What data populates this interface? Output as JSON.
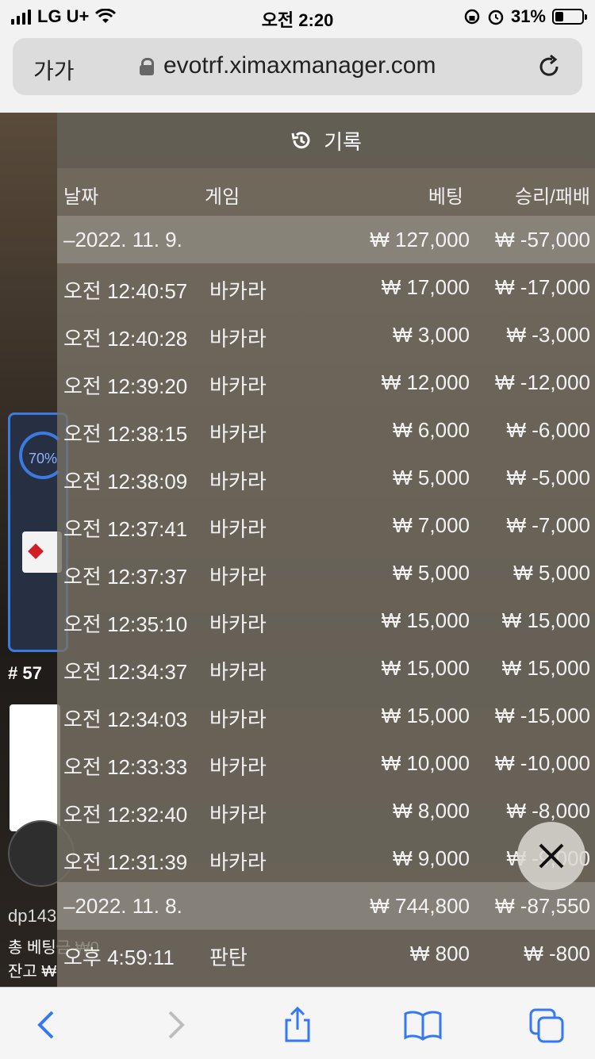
{
  "status_bar": {
    "carrier": "LG U+",
    "time": "오전 2:20",
    "battery": "31%",
    "battery_level": 0.31
  },
  "browser": {
    "text_size_button": "가가",
    "url": "evotrf.ximaxmanager.com"
  },
  "background_page": {
    "progress": "70%",
    "table_number": "# 57",
    "username": "dp143",
    "total_bet": "총 베팅금 ₩0",
    "balance": "잔고 ₩"
  },
  "history_panel": {
    "title": "기록",
    "columns": {
      "date": "날짜",
      "game": "게임",
      "bet": "베팅",
      "result": "승리/패배"
    },
    "rows": [
      {
        "type": "date",
        "date": "–2022. 11. 9.",
        "bet": "₩ 127,000",
        "result": "₩ -57,000"
      },
      {
        "type": "entry",
        "time": "오전 12:40:57",
        "game": "바카라",
        "bet": "₩ 17,000",
        "result": "₩ -17,000"
      },
      {
        "type": "entry",
        "time": "오전 12:40:28",
        "game": "바카라",
        "bet": "₩ 3,000",
        "result": "₩ -3,000"
      },
      {
        "type": "entry",
        "time": "오전 12:39:20",
        "game": "바카라",
        "bet": "₩ 12,000",
        "result": "₩ -12,000"
      },
      {
        "type": "entry",
        "time": "오전 12:38:15",
        "game": "바카라",
        "bet": "₩ 6,000",
        "result": "₩ -6,000"
      },
      {
        "type": "entry",
        "time": "오전 12:38:09",
        "game": "바카라",
        "bet": "₩ 5,000",
        "result": "₩ -5,000"
      },
      {
        "type": "entry",
        "time": "오전 12:37:41",
        "game": "바카라",
        "bet": "₩ 7,000",
        "result": "₩ -7,000"
      },
      {
        "type": "entry",
        "time": "오전 12:37:37",
        "game": "바카라",
        "bet": "₩ 5,000",
        "result": "₩ 5,000"
      },
      {
        "type": "entry",
        "time": "오전 12:35:10",
        "game": "바카라",
        "bet": "₩ 15,000",
        "result": "₩ 15,000"
      },
      {
        "type": "entry",
        "time": "오전 12:34:37",
        "game": "바카라",
        "bet": "₩ 15,000",
        "result": "₩ 15,000"
      },
      {
        "type": "entry",
        "time": "오전 12:34:03",
        "game": "바카라",
        "bet": "₩ 15,000",
        "result": "₩ -15,000"
      },
      {
        "type": "entry",
        "time": "오전 12:33:33",
        "game": "바카라",
        "bet": "₩ 10,000",
        "result": "₩ -10,000"
      },
      {
        "type": "entry",
        "time": "오전 12:32:40",
        "game": "바카라",
        "bet": "₩ 8,000",
        "result": "₩ -8,000"
      },
      {
        "type": "entry",
        "time": "오전 12:31:39",
        "game": "바카라",
        "bet": "₩ 9,000",
        "result": "₩ -9,000"
      },
      {
        "type": "date",
        "date": "–2022. 11. 8.",
        "bet": "₩ 744,800",
        "result": "₩ -87,550"
      },
      {
        "type": "entry",
        "time": "오후 4:59:11",
        "game": "판탄",
        "bet": "₩ 800",
        "result": "₩ -800"
      }
    ]
  },
  "colors": {
    "accent": "#3d7ae0",
    "toolbar_icon": "#3478f6"
  }
}
